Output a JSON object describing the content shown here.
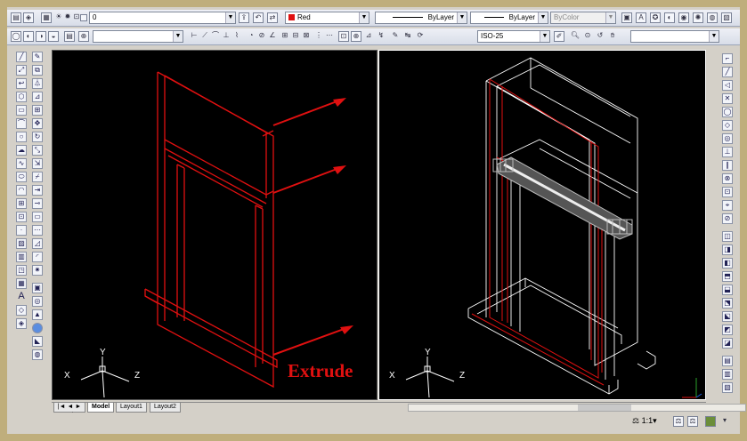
{
  "toolbar_top": {
    "layer_value": "0",
    "color_value": "Red",
    "linetype_value": "ByLayer",
    "lineweight_value": "ByLayer",
    "plotstyle_value": "ByColor"
  },
  "toolbar_second": {
    "dimstyle_value": "ISO-25"
  },
  "left_view": {
    "label": "Extrude",
    "ucs": {
      "x": "X",
      "y": "Y",
      "z": "Z"
    }
  },
  "right_view": {
    "ucs": {
      "x": "X",
      "y": "Y",
      "z": "Z"
    }
  },
  "tabs": [
    "Model",
    "Layout1",
    "Layout2"
  ],
  "status": {
    "scale": "1:1"
  },
  "colors": {
    "model_red": "#e01010",
    "wire_white": "#ffffff",
    "background": "#000000",
    "tab_active": "#ffffff"
  }
}
